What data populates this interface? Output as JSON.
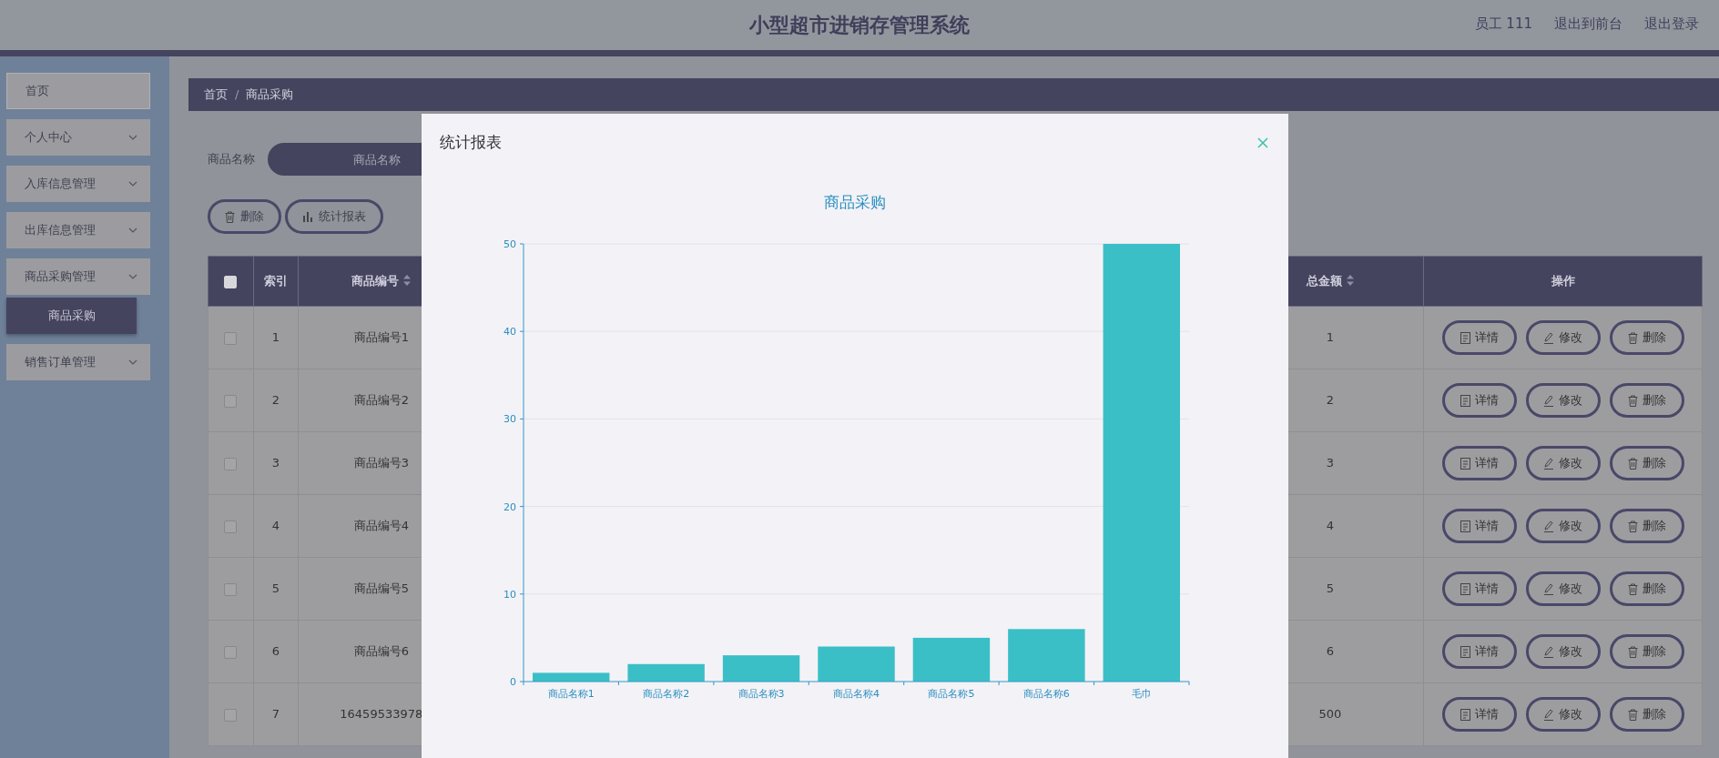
{
  "header": {
    "title": "小型超市进销存管理系统",
    "user": "员工 111",
    "links": [
      "退出到前台",
      "退出登录"
    ]
  },
  "sidebar": {
    "items": [
      {
        "label": "首页",
        "kind": "link"
      },
      {
        "label": "个人中心",
        "kind": "menu"
      },
      {
        "label": "入库信息管理",
        "kind": "menu"
      },
      {
        "label": "出库信息管理",
        "kind": "menu"
      },
      {
        "label": "商品采购管理",
        "kind": "menu",
        "children": [
          {
            "label": "商品采购",
            "selected": true
          }
        ]
      },
      {
        "label": "销售订单管理",
        "kind": "menu"
      }
    ]
  },
  "breadcrumb": {
    "items": [
      "首页",
      "商品采购"
    ],
    "separator": "/"
  },
  "search": {
    "label": "商品名称",
    "placeholder": "商品名称"
  },
  "toolbar": [
    {
      "label": "删除",
      "kind": "delete"
    },
    {
      "label": "统计报表",
      "kind": "chart"
    }
  ],
  "table": {
    "select_all": {
      "checked": false
    },
    "columns": [
      {
        "label": "索引",
        "sortable": false
      },
      {
        "label": "商品编号",
        "sortable": true
      },
      {
        "label": "总金额",
        "sortable": true
      },
      {
        "label": "操作",
        "sortable": false
      }
    ],
    "rows": [
      {
        "checked": false,
        "index": "1",
        "code": "商品编号1",
        "total": "1",
        "actions": [
          "详情",
          "修改",
          "删除"
        ]
      },
      {
        "checked": false,
        "index": "2",
        "code": "商品编号2",
        "total": "2",
        "actions": [
          "详情",
          "修改",
          "删除"
        ]
      },
      {
        "checked": false,
        "index": "3",
        "code": "商品编号3",
        "total": "3",
        "actions": [
          "详情",
          "修改",
          "删除"
        ]
      },
      {
        "checked": false,
        "index": "4",
        "code": "商品编号4",
        "total": "4",
        "actions": [
          "详情",
          "修改",
          "删除"
        ]
      },
      {
        "checked": false,
        "index": "5",
        "code": "商品编号5",
        "total": "5",
        "actions": [
          "详情",
          "修改",
          "删除"
        ]
      },
      {
        "checked": false,
        "index": "6",
        "code": "商品编号6",
        "total": "6",
        "actions": [
          "详情",
          "修改",
          "删除"
        ]
      },
      {
        "checked": false,
        "index": "7",
        "code": "16459533978",
        "total": "500",
        "actions": [
          "详情",
          "修改",
          "删除"
        ]
      }
    ]
  },
  "modal": {
    "title": "统计报表",
    "chart_data": {
      "type": "bar",
      "title": "商品采购",
      "categories": [
        "商品名称1",
        "商品名称2",
        "商品名称3",
        "商品名称4",
        "商品名称5",
        "商品名称6",
        "毛巾"
      ],
      "values": [
        1,
        2,
        3,
        4,
        5,
        6,
        50
      ],
      "ylim": [
        0,
        50
      ],
      "yticks": [
        0,
        10,
        20,
        30,
        40,
        50
      ],
      "grid": true
    }
  }
}
